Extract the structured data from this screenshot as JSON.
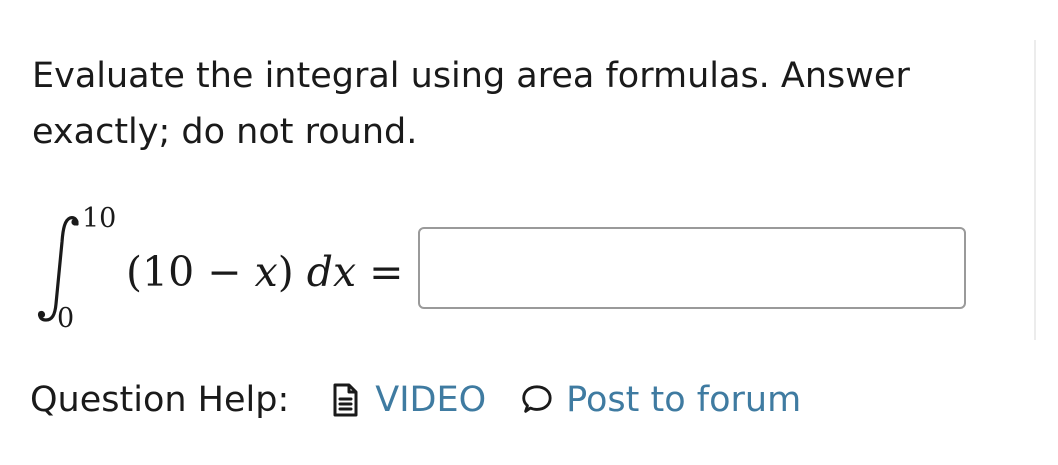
{
  "question": {
    "prompt_line1": "Evaluate the integral using area formulas. Answer",
    "prompt_line2": "exactly; do not round."
  },
  "integral": {
    "upper_limit": "10",
    "lower_limit": "0",
    "integrand_open": "(10 − ",
    "integrand_var": "x",
    "integrand_close": ") ",
    "differential": "dx",
    "equals": " ="
  },
  "answer_field": {
    "value": "",
    "placeholder": ""
  },
  "help": {
    "label": "Question Help:",
    "video_icon": "document-icon",
    "video_label": "VIDEO",
    "forum_icon": "speech-bubble-icon",
    "forum_label": "Post to forum",
    "link_color": "#3f7ba1"
  }
}
